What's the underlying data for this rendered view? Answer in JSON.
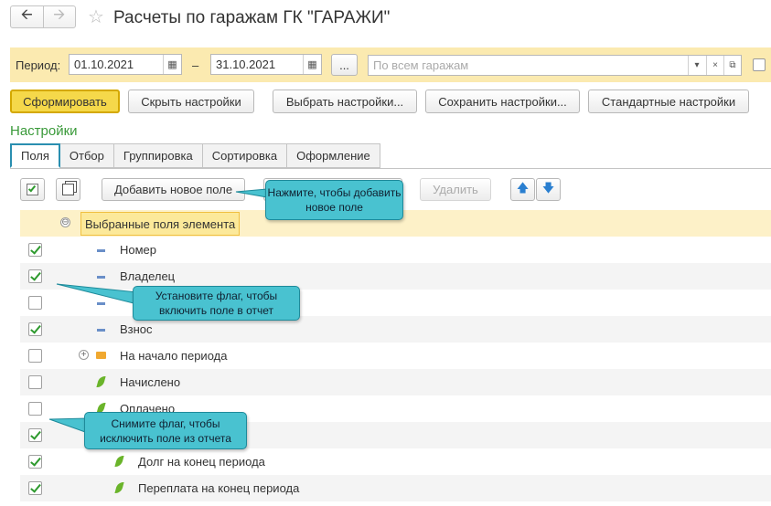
{
  "header": {
    "back_icon": "arrow-left-icon",
    "forward_icon": "arrow-right-icon",
    "favorite_icon": "star-icon",
    "title": "Расчеты по гаражам ГК \"ГАРАЖИ\""
  },
  "period": {
    "label": "Период:",
    "from": "01.10.2021",
    "separator": "–",
    "to": "31.10.2021",
    "more_label": "...",
    "garage_placeholder": "По всем гаражам",
    "clear_label": "×"
  },
  "actions": {
    "generate": "Сформировать",
    "hide_settings": "Скрыть настройки",
    "choose_settings": "Выбрать настройки...",
    "save_settings": "Сохранить настройки...",
    "default_settings": "Стандартные настройки"
  },
  "settings": {
    "title": "Настройки",
    "tabs": [
      "Поля",
      "Отбор",
      "Группировка",
      "Сортировка",
      "Оформление"
    ],
    "active_tab": "Поля"
  },
  "toolbar": {
    "add_field": "Добавить новое поле",
    "delete": "Удалить"
  },
  "tree": {
    "root": "Выбранные поля элемента",
    "rows": [
      {
        "label": "Номер",
        "checked": true
      },
      {
        "label": "Владелец",
        "checked": true
      },
      {
        "label": "",
        "checked": false
      },
      {
        "label": "Взнос",
        "checked": true
      },
      {
        "label": "На начало периода",
        "checked": false
      },
      {
        "label": "Начислено",
        "checked": false
      },
      {
        "label": "Оплачено",
        "checked": false
      },
      {
        "label": "",
        "checked": true
      },
      {
        "label": "Долг на конец периода",
        "checked": true
      },
      {
        "label": "Переплата на конец периода",
        "checked": true
      }
    ]
  },
  "callouts": {
    "add_field_hint": "Нажмите, чтобы добавить новое поле",
    "check_hint": "Установите флаг, чтобы включить поле в отчет",
    "uncheck_hint": "Снимите флаг, чтобы исключить поле из отчета"
  },
  "colors": {
    "accent": "#2a8fb0",
    "period_bar": "#fbeab0",
    "primary_button": "#f5d84a",
    "callout": "#49c2d0",
    "settings_title": "#3a9a3a"
  }
}
